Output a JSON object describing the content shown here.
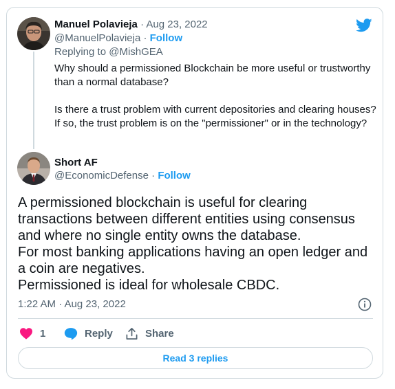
{
  "colors": {
    "accent": "#1d9bf0",
    "text": "#0f1419",
    "secondary": "#536471",
    "border": "#cfd9de",
    "like": "#f91880"
  },
  "quoted_tweet": {
    "author_name": "Manuel Polavieja",
    "date": "· Aug 23, 2022",
    "handle": "@ManuelPolavieja",
    "separator": "·",
    "follow_label": "Follow",
    "replying_to_prefix": "Replying to ",
    "replying_to_handle": "@MishGEA",
    "paragraph_1": "Why should a permissioned Blockchain be more useful or trustworthy than a normal database?",
    "paragraph_2": "Is there a trust problem with current depositories and  clearing houses? If so, the trust problem is on the \"permissioner\" or in the technology?"
  },
  "main_tweet": {
    "author_name": "Short AF",
    "handle": "@EconomicDefense",
    "separator": "·",
    "follow_label": "Follow",
    "lines": [
      "A permissioned blockchain is useful for clearing",
      "transactions between different entities using consensus",
      "and where no single entity owns the database.",
      "For most banking applications having an open ledger and",
      "a coin are negatives.",
      "Permissioned is ideal for wholesale CBDC."
    ],
    "timestamp": "1:22 AM · Aug 23, 2022"
  },
  "actions": {
    "like_count": "1",
    "reply_label": "Reply",
    "share_label": "Share",
    "read_replies_label": "Read 3 replies"
  },
  "icons": {
    "brand": "twitter-bird-icon",
    "like": "heart-icon",
    "reply": "speech-bubble-icon",
    "share": "share-arrow-icon",
    "info": "info-icon"
  }
}
